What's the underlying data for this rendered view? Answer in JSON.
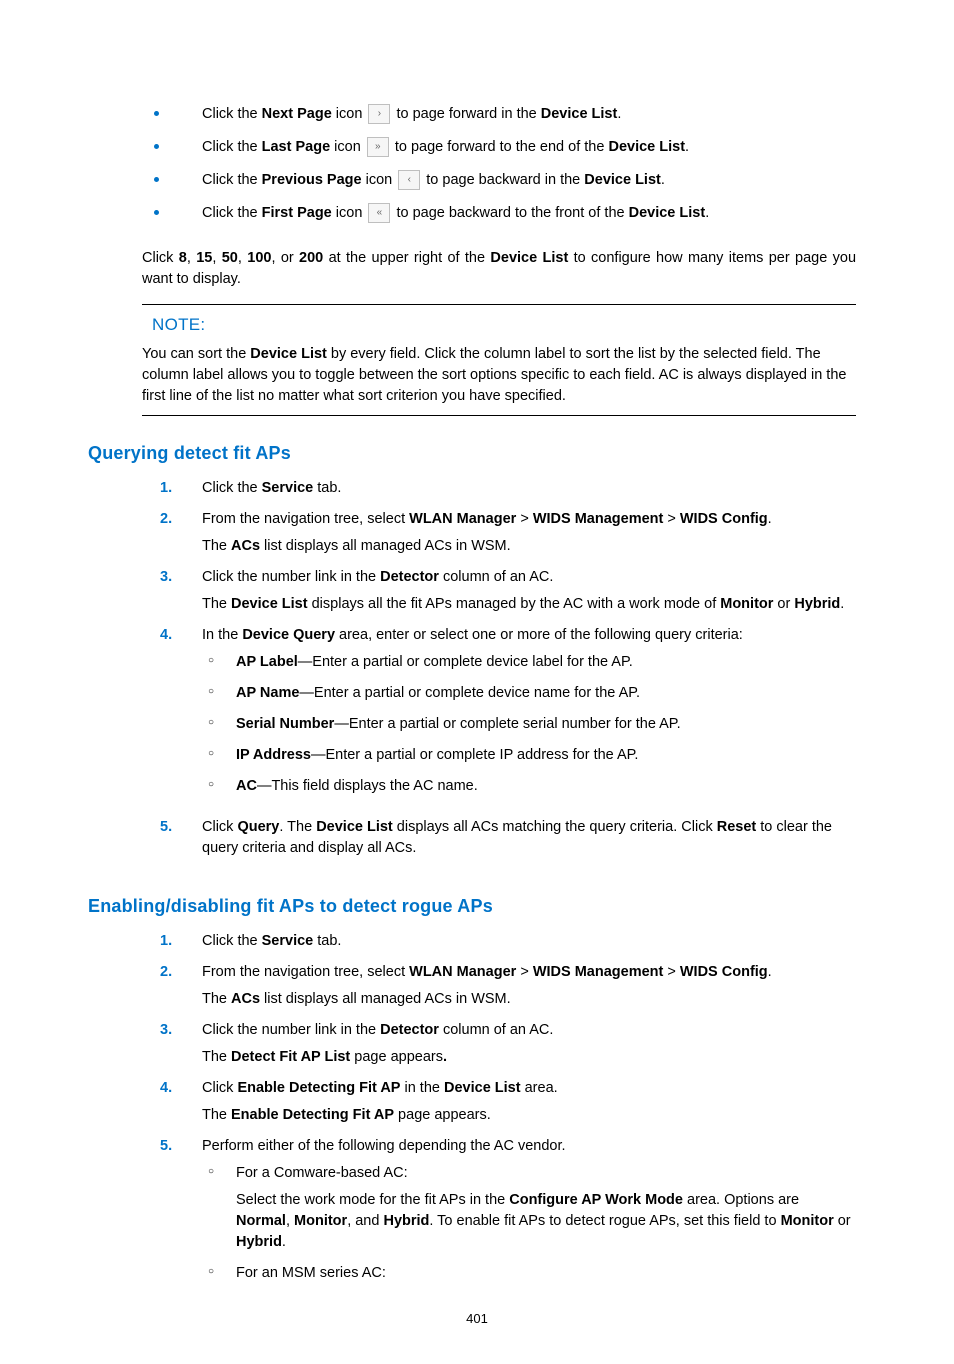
{
  "icon_bullets": [
    {
      "pre": "Click the ",
      "bold1": "Next Page",
      "mid": " icon ",
      "glyph": "›",
      "post": " to page forward in the ",
      "bold2": "Device List",
      "tail": "."
    },
    {
      "pre": "Click the ",
      "bold1": "Last Page",
      "mid": " icon ",
      "glyph": "»",
      "post": " to page forward to the end of the ",
      "bold2": "Device List",
      "tail": "."
    },
    {
      "pre": "Click the ",
      "bold1": "Previous Page",
      "mid": " icon ",
      "glyph": "‹",
      "post": " to page backward in the ",
      "bold2": "Device List",
      "tail": "."
    },
    {
      "pre": "Click the ",
      "bold1": "First Page",
      "mid": " icon ",
      "glyph": "«",
      "post": " to page backward to the front of the ",
      "bold2": "Device List",
      "tail": "."
    }
  ],
  "pager_para": {
    "t1": "Click ",
    "n1": "8",
    "c1": ", ",
    "n2": "15",
    "c2": ", ",
    "n3": "50",
    "c3": ", ",
    "n4": "100",
    "c4": ", or ",
    "n5": "200",
    "t2": " at the upper right of the ",
    "dl": "Device List",
    "t3": " to configure how many items per page you want to display."
  },
  "note_label": "NOTE:",
  "note_body": {
    "t1": "You can sort the ",
    "b1": "Device List",
    "t2": " by every field. Click the column label to sort the list by the selected field. The column label allows you to toggle between the sort options specific to each field. AC is always displayed in the first line of the list no matter what sort criterion you have specified."
  },
  "h_query": "Querying detect fit APs",
  "q1": {
    "t1": "Click the ",
    "b1": "Service",
    "t2": " tab."
  },
  "q2": {
    "t1": "From the navigation tree, select ",
    "b1": "WLAN Manager",
    "g1": " > ",
    "b2": "WIDS Management",
    "g2": " > ",
    "b3": "WIDS Config",
    "t2": ".",
    "sub_a": "The ",
    "sub_b": "ACs",
    "sub_c": " list displays all managed ACs in WSM."
  },
  "q3": {
    "t1": "Click the number link in the ",
    "b1": "Detector",
    "t2": " column of an AC.",
    "sub_a": "The ",
    "sub_b": "Device List",
    "sub_c": " displays all the fit APs managed by the AC with a work mode of ",
    "sub_d": "Monitor",
    "sub_e": " or ",
    "sub_f": "Hybrid",
    "sub_g": "."
  },
  "q4": {
    "t1": "In the ",
    "b1": "Device Query",
    "t2": " area, enter or select one or more of the following query criteria:"
  },
  "q4_items": [
    {
      "b": "AP Label",
      "t": "—Enter a partial or complete device label for the AP."
    },
    {
      "b": "AP Name",
      "t": "—Enter a partial or complete device name for the AP."
    },
    {
      "b": "Serial Number",
      "t": "—Enter a partial or complete serial number for the AP."
    },
    {
      "b": "IP Address",
      "t": "—Enter a partial or complete IP address for the AP."
    },
    {
      "b": "AC",
      "t": "—This field displays the AC name."
    }
  ],
  "q5": {
    "t1": "Click ",
    "b1": "Query",
    "t2": ". The ",
    "b2": "Device List",
    "t3": " displays all ACs matching the query criteria. Click ",
    "b3": "Reset",
    "t4": " to clear the query criteria and display all ACs."
  },
  "h_enable": "Enabling/disabling fit APs to detect rogue APs",
  "e1": {
    "t1": "Click the ",
    "b1": "Service",
    "t2": " tab."
  },
  "e2": {
    "t1": "From the navigation tree, select ",
    "b1": "WLAN Manager",
    "g1": " > ",
    "b2": "WIDS Management",
    "g2": " > ",
    "b3": "WIDS Config",
    "t2": ".",
    "sub_a": "The ",
    "sub_b": "ACs",
    "sub_c": " list displays all managed ACs in WSM."
  },
  "e3": {
    "t1": "Click the number link in the ",
    "b1": "Detector",
    "t2": " column of an AC.",
    "sub_a": "The ",
    "sub_b": "Detect Fit AP List",
    "sub_c": " page appears",
    "sub_d": "."
  },
  "e4": {
    "t1": "Click ",
    "b1": "Enable Detecting Fit AP",
    "t2": " in the ",
    "b2": "Device List",
    "t3": " area.",
    "sub_a": "The ",
    "sub_b": "Enable Detecting Fit AP",
    "sub_c": " page appears."
  },
  "e5": {
    "t1": "Perform either of the following depending the AC vendor."
  },
  "e5_a": {
    "lead": "For a Comware-based AC:",
    "t1": "Select the work mode for the fit APs in the ",
    "b1": "Configure AP Work Mode",
    "t2": " area. Options are ",
    "b2": "Normal",
    "c1": ", ",
    "b3": "Monitor",
    "c2": ", and ",
    "b4": "Hybrid",
    "t3": ". To enable fit APs to detect rogue APs, set this field to ",
    "b5": "Monitor",
    "t4": " or ",
    "b6": "Hybrid",
    "t5": "."
  },
  "e5_b": {
    "lead": "For an MSM series AC:"
  },
  "page_number": "401"
}
